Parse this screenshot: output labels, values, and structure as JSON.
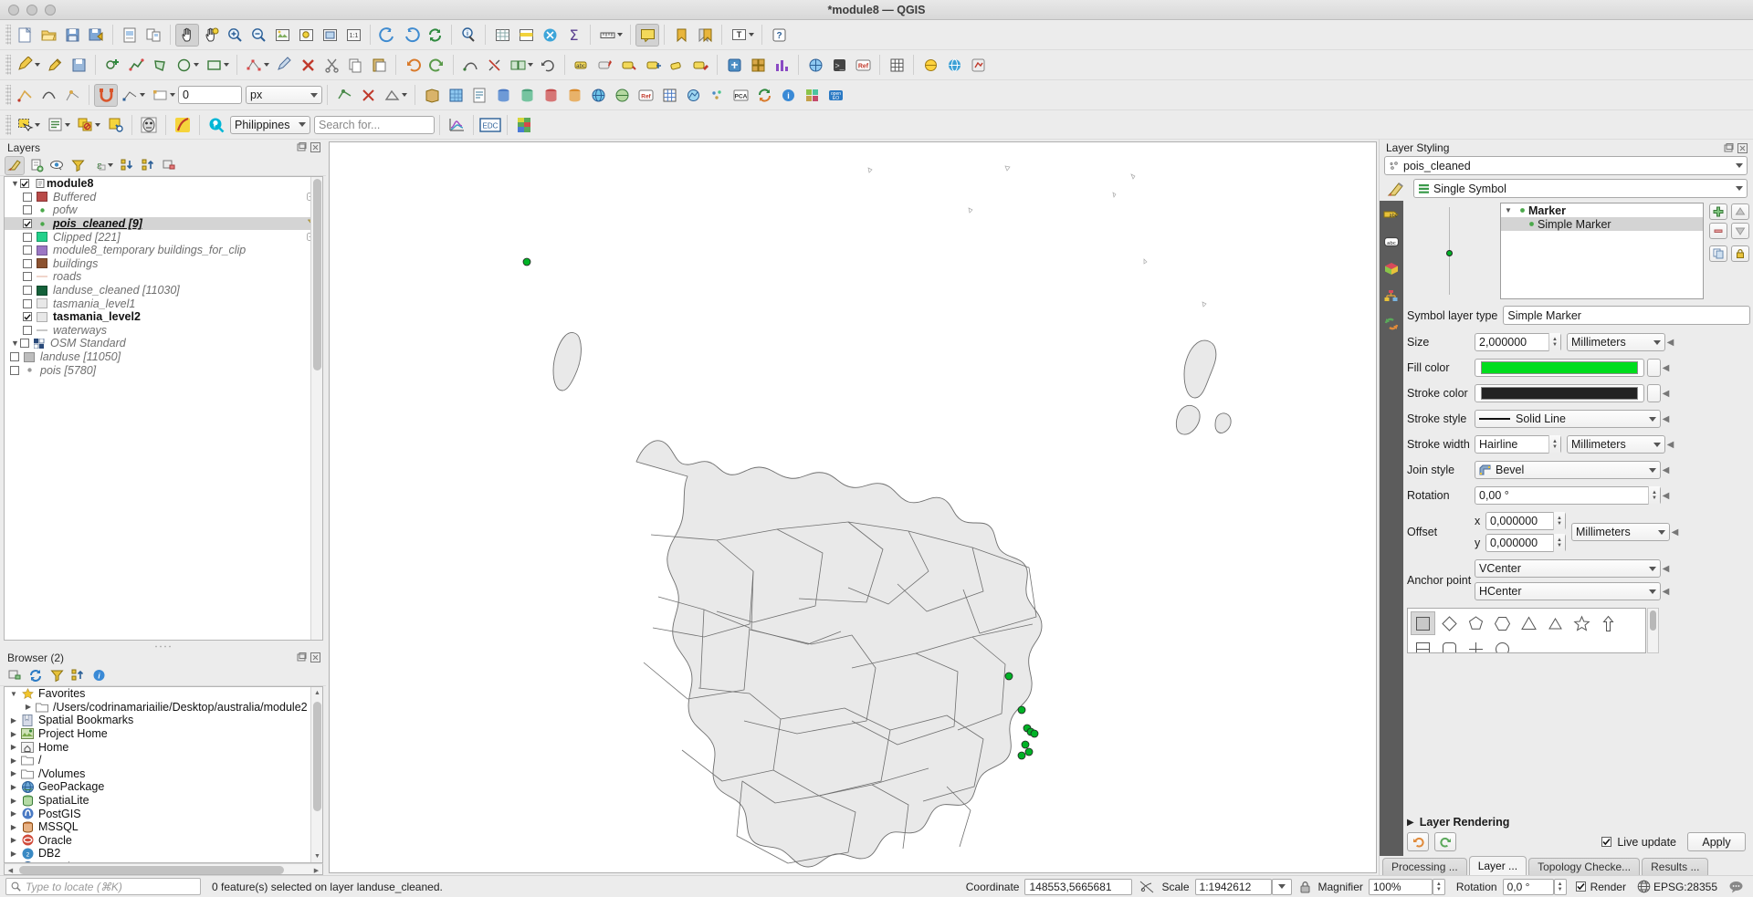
{
  "window": {
    "title": "*module8 — QGIS"
  },
  "toolbars": {
    "row1": [
      "new-project",
      "open-project",
      "save-project",
      "save-project-as",
      "new-print-layout",
      "show-layout-manager",
      "pan-map",
      "pan-to-selection",
      "zoom-in",
      "zoom-out",
      "zoom-full",
      "zoom-selection",
      "zoom-layer",
      "zoom-native",
      "zoom-last",
      "zoom-next",
      "refresh",
      "identify-features",
      "open-attribute-table",
      "select-features",
      "field-calculator",
      "measure-line",
      "show-map-tips",
      "new-bookmark",
      "show-bookmarks",
      "text-annotation",
      "help"
    ],
    "row2": [
      "current-edits",
      "toggle-editing",
      "save-layer-edits",
      "add-feature",
      "move-feature",
      "node-tool",
      "delete-selected",
      "cut-features",
      "copy-features",
      "paste-features",
      "undo",
      "redo",
      "vertex-tool",
      "reshape",
      "split",
      "merge",
      "rotate-label",
      "label",
      "pin-label",
      "show-hide-label",
      "move-label",
      "change-label",
      "processing-toolbox",
      "create-grid",
      "statistical-summary",
      "georeferencer",
      "python-console",
      "info"
    ],
    "row3": [
      "digitize-with-segment",
      "trace",
      "snapping-enabled",
      "snapping-mode",
      "tolerance-value",
      "tolerance-units",
      "enable-topological-editing",
      "avoid-overlap",
      "select-features-by-value",
      "deselect",
      "open-layer-styling",
      "add-vector-layer",
      "add-raster-layer",
      "add-delimited-text",
      "add-postgis",
      "add-spatialite",
      "add-mssql",
      "add-wms",
      "add-wcs",
      "add-wfs",
      "add-mesh",
      "add-vector-tile",
      "add-point-cloud",
      "add-xyz",
      "pca-plugin",
      "refresh-plugin",
      "info-plugin",
      "qgis2web",
      "open-eo"
    ],
    "row4": [
      "select-features-rect",
      "select-by-expression",
      "select-by-location",
      "select-by-value",
      "deselect-all",
      "identify-raster",
      "plugin-osm",
      "search-provider",
      "scale-chart",
      "edc",
      "sld"
    ]
  },
  "plugin_search": {
    "country_value": "Philippines",
    "search_placeholder": "Search for..."
  },
  "tolerance": {
    "value": "0",
    "units": "px"
  },
  "layers_panel": {
    "title": "Layers",
    "toolbar": [
      "open-layer-styling-panel",
      "add-group",
      "manage-map-themes",
      "filter-legend",
      "expression-filter",
      "expand-all",
      "collapse-all",
      "remove-layer"
    ],
    "root": {
      "label": "module8",
      "checked": true,
      "expanded": true
    },
    "items": [
      {
        "label": "Buffered",
        "checked": false,
        "style": "italic",
        "swatch": "#b94a48",
        "indent": 2
      },
      {
        "label": "pofw",
        "checked": false,
        "style": "italic",
        "swatch": "point-green",
        "indent": 2
      },
      {
        "label": "pois_cleaned [9]",
        "checked": true,
        "style": "bold-underline",
        "swatch": "point-green",
        "indent": 2,
        "selected": true,
        "filtered": true
      },
      {
        "label": "Clipped [221]",
        "checked": false,
        "style": "italic",
        "swatch": "#23d18b",
        "indent": 2
      },
      {
        "label": "module8_temporary buildings_for_clip",
        "checked": false,
        "style": "italic",
        "swatch": "#9b77c4",
        "indent": 2
      },
      {
        "label": "buildings",
        "checked": false,
        "style": "italic",
        "swatch": "#8c5230",
        "indent": 2
      },
      {
        "label": "roads",
        "checked": false,
        "style": "italic",
        "swatch": "line-pink",
        "indent": 2
      },
      {
        "label": "landuse_cleaned [11030]",
        "checked": false,
        "style": "italic",
        "swatch": "#14613a",
        "indent": 2
      },
      {
        "label": "tasmania_level1",
        "checked": false,
        "style": "italic",
        "swatch": "#e8e8e8",
        "indent": 2
      },
      {
        "label": "tasmania_level2",
        "checked": true,
        "style": "bold",
        "swatch": "#e8e8e8",
        "indent": 2
      },
      {
        "label": "waterways",
        "checked": false,
        "style": "italic",
        "swatch": "line-grey",
        "indent": 2
      },
      {
        "label": "OSM Standard",
        "checked": false,
        "style": "italic",
        "swatch": "xyz-tiles",
        "indent": 1,
        "expandable": true
      },
      {
        "label": "landuse [11050]",
        "checked": false,
        "style": "italic",
        "swatch": "#bdbdbd",
        "indent": 1
      },
      {
        "label": "pois [5780]",
        "checked": false,
        "style": "italic",
        "swatch": "point-grey",
        "indent": 1
      }
    ]
  },
  "browser_panel": {
    "title": "Browser (2)",
    "toolbar": [
      "add-selected-layers",
      "refresh",
      "filter-browser",
      "collapse-all",
      "properties"
    ],
    "items": [
      {
        "label": "Favorites",
        "icon": "star-icon",
        "indent": 0,
        "expanded": true
      },
      {
        "label": "/Users/codrinamariailie/Desktop/australia/module2",
        "icon": "folder-icon",
        "indent": 1
      },
      {
        "label": "Spatial Bookmarks",
        "icon": "bookmark-icon",
        "indent": 0
      },
      {
        "label": "Project Home",
        "icon": "project-home-icon",
        "indent": 0
      },
      {
        "label": "Home",
        "icon": "home-icon",
        "indent": 0
      },
      {
        "label": "/",
        "icon": "folder-icon",
        "indent": 0
      },
      {
        "label": "/Volumes",
        "icon": "folder-icon",
        "indent": 0
      },
      {
        "label": "GeoPackage",
        "icon": "geopackage-icon",
        "indent": 0
      },
      {
        "label": "SpatiaLite",
        "icon": "spatialite-icon",
        "indent": 0
      },
      {
        "label": "PostGIS",
        "icon": "postgis-icon",
        "indent": 0
      },
      {
        "label": "MSSQL",
        "icon": "mssql-icon",
        "indent": 0
      },
      {
        "label": "Oracle",
        "icon": "oracle-icon",
        "indent": 0
      },
      {
        "label": "DB2",
        "icon": "db2-icon",
        "indent": 0
      },
      {
        "label": "WMS/WMTS",
        "icon": "wms-icon",
        "indent": 0
      }
    ]
  },
  "layer_styling": {
    "title": "Layer Styling",
    "layer_name": "pois_cleaned",
    "renderer": "Single Symbol",
    "symbol_tree": [
      {
        "label": "Marker",
        "level": 0,
        "bold": true
      },
      {
        "label": "Simple Marker",
        "level": 1,
        "bold": false,
        "selected": true
      }
    ],
    "symbol_layer_type_label": "Symbol layer type",
    "symbol_layer_type_value": "Simple Marker",
    "fields": {
      "size_label": "Size",
      "size_value": "2,000000",
      "size_units": "Millimeters",
      "fill_color_label": "Fill color",
      "fill_color": "#00DD1E",
      "stroke_color_label": "Stroke color",
      "stroke_color": "#232323",
      "stroke_style_label": "Stroke style",
      "stroke_style_value": "Solid Line",
      "stroke_width_label": "Stroke width",
      "stroke_width_value": "Hairline",
      "stroke_width_units": "Millimeters",
      "join_style_label": "Join style",
      "join_style_value": "Bevel",
      "rotation_label": "Rotation",
      "rotation_value": "0,00 °",
      "offset_label": "Offset",
      "offset_x_label": "x",
      "offset_x_value": "0,000000",
      "offset_y_label": "y",
      "offset_y_value": "0,000000",
      "offset_units": "Millimeters",
      "anchor_label": "Anchor point",
      "anchor_v_value": "VCenter",
      "anchor_h_value": "HCenter"
    },
    "layer_rendering_label": "Layer Rendering",
    "live_update_label": "Live update",
    "live_update_checked": true,
    "apply_label": "Apply",
    "undo_icon": "undo-icon",
    "redo_icon": "redo-icon",
    "vertical_tabs": [
      "labels-tab",
      "masks-tab",
      "3d-view-tab",
      "diagrams-tab",
      "history-tab"
    ]
  },
  "bottom_tabs": [
    {
      "label": "Processing ...",
      "active": false
    },
    {
      "label": "Layer ...",
      "active": true
    },
    {
      "label": "Topology Checke...",
      "active": false
    },
    {
      "label": "Results ...",
      "active": false
    }
  ],
  "status_bar": {
    "locate_placeholder": "Type to locate (⌘K)",
    "message": "0 feature(s) selected on layer landuse_cleaned.",
    "coordinate_label": "Coordinate",
    "coordinate_value": "148553,5665681",
    "scale_label": "Scale",
    "scale_value": "1:1942612",
    "magnifier_label": "Magnifier",
    "magnifier_value": "100%",
    "rotation_label": "Rotation",
    "rotation_value": "0,0 °",
    "render_label": "Render",
    "render_checked": true,
    "crs_label": "EPSG:28355",
    "messages_icon": "messages-icon",
    "lock_icon": "lock-icon"
  },
  "map": {
    "layer_rendered": "tasmania_level2",
    "point_layer": "pois_cleaned",
    "point_color": "#00b226"
  }
}
